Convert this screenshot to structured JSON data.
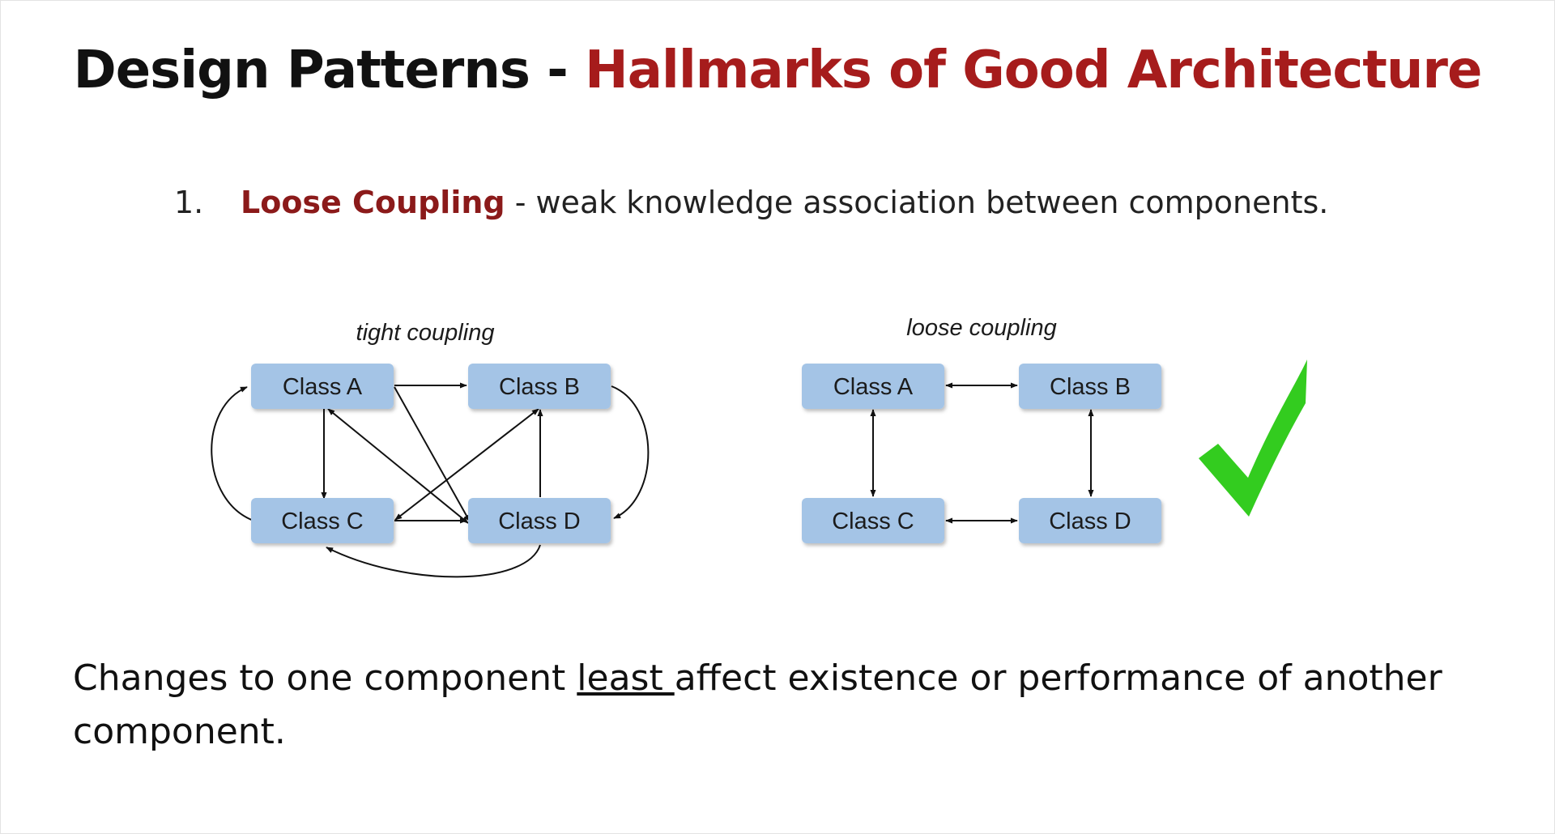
{
  "slide": {
    "title_main": "Design Patterns - ",
    "title_accent": "Hallmarks of Good Architecture",
    "bullet_number": "1.",
    "bullet_term": "Loose Coupling",
    "bullet_rest": " - weak knowledge association between components.",
    "bottom_before": "Changes to one component ",
    "bottom_underlined": "least ",
    "bottom_after": "affect existence or performance of another component."
  },
  "diagrams": {
    "tight": {
      "caption": "tight coupling",
      "nodes": [
        "Class A",
        "Class B",
        "Class C",
        "Class D"
      ]
    },
    "loose": {
      "caption": "loose coupling",
      "nodes": [
        "Class A",
        "Class B",
        "Class C",
        "Class D"
      ]
    }
  },
  "colors": {
    "title_accent": "#a61c1c",
    "term": "#8b1a1a",
    "node_fill": "#a4c4e6",
    "checkmark": "#33cc1f"
  },
  "icons": {
    "checkmark": "checkmark-icon"
  }
}
